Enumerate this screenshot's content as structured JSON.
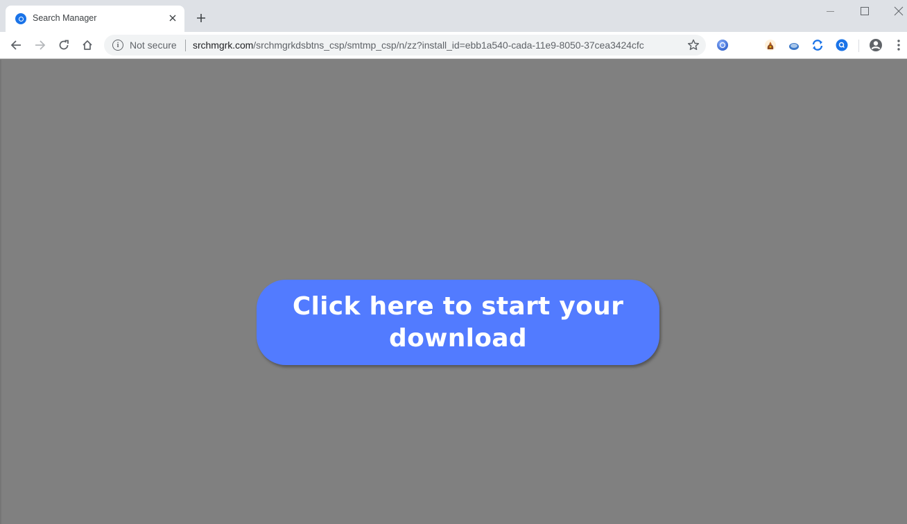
{
  "browser": {
    "tab": {
      "title": "Search Manager",
      "favicon": "search-manager-icon",
      "close_label": "×"
    },
    "new_tab_label": "+",
    "window_controls": [
      "minimize",
      "maximize",
      "close"
    ],
    "nav": {
      "back": "back-arrow-icon",
      "forward": "forward-arrow-icon",
      "reload": "reload-icon",
      "home": "home-icon"
    },
    "omnibox": {
      "security_label": "Not secure",
      "url_host": "srchmgrk.com",
      "url_path": "/srchmgrkdsbtns_csp/smtmp_csp/n/zz?install_id=ebb1a540-cada-11e9-8050-37cea3424cfc"
    },
    "extensions": [
      "blue-globe-extension-icon",
      "brown-bag-extension-icon",
      "blue-oval-extension-icon",
      "sync-extension-icon",
      "search-extension-icon"
    ],
    "colors": {
      "accent": "#1a73e8",
      "titlebar": "#dee1e6"
    }
  },
  "page": {
    "background": "#808080",
    "cta": {
      "label": "Click here to start your download",
      "color": "#527bff"
    }
  }
}
